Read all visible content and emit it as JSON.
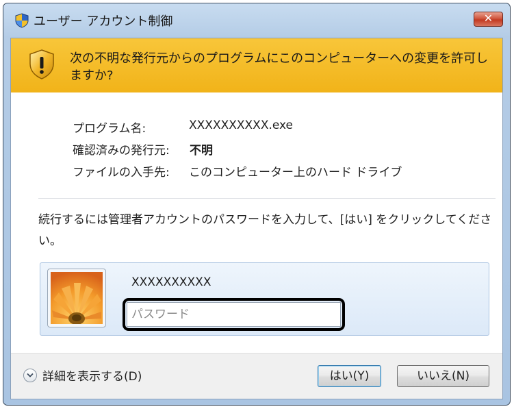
{
  "window": {
    "title": "ユーザー アカウント制御",
    "close_symbol": "✕"
  },
  "banner": {
    "message": "次の不明な発行元からのプログラムにこのコンピューターへの変更を許可しますか?"
  },
  "details": {
    "program_label": "プログラム名:",
    "program_value": "XXXXXXXXXX.exe",
    "publisher_label": "確認済みの発行元:",
    "publisher_value": "不明",
    "origin_label": "ファイルの入手先:",
    "origin_value": "このコンピューター上のハード ドライブ"
  },
  "instruction": "続行するには管理者アカウントのパスワードを入力して、[はい] をクリックしてください。",
  "credentials": {
    "username": "XXXXXXXXXX",
    "password_value": "",
    "password_placeholder": "パスワード"
  },
  "footer": {
    "details_toggle_label": "詳細を表示する(D)",
    "yes_label": "はい(Y)",
    "no_label": "いいえ(N)"
  },
  "icons": {
    "title_icon": "uac-shield-icon",
    "banner_icon": "warning-shield-icon",
    "avatar": "flower-avatar",
    "toggle_icon": "chevron-down-icon"
  },
  "colors": {
    "banner": "#f1b319",
    "close_button": "#c23a22",
    "frame": "#b4cce6",
    "panel": "#dce9f8"
  }
}
